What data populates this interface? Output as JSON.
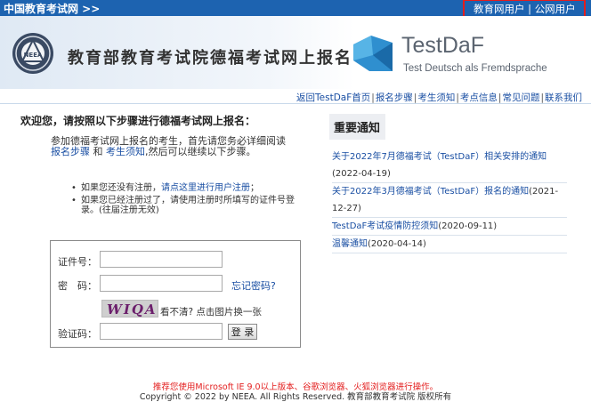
{
  "topbar": {
    "site_name": "中国教育考试网 >>",
    "user_link_edu": "教育网用户",
    "user_sep": " | ",
    "user_link_public": "公网用户",
    "highlight_color": "#e31d1d",
    "bg_color": "#1d63b0"
  },
  "banner": {
    "title": "教育部教育考试院德福考试网上报名",
    "logo_text": "NEEA",
    "brand_name": "TestDaF",
    "brand_sub": "Test Deutsch als Fremdsprache"
  },
  "nav": {
    "items": [
      {
        "label": "返回TestDaF首页"
      },
      {
        "label": "报名步骤"
      },
      {
        "label": "考生须知"
      },
      {
        "label": "考点信息"
      },
      {
        "label": "常见问题"
      },
      {
        "label": "联系我们"
      }
    ],
    "separator": "|"
  },
  "welcome": {
    "heading": "欢迎您，请按照以下步骤进行德福考试网上报名：",
    "intro_before": "参加德福考试网上报名的考生，首先请您务必详细阅读",
    "intro_link1": "报名步骤",
    "intro_and": "和",
    "intro_link2": "考生须知",
    "intro_after": ",然后可以继续以下步骤。",
    "bullet1_before": "如果您还没有注册，",
    "bullet1_link": "请点这里进行用户注册",
    "bullet1_after": "；",
    "bullet2": "如果您已经注册过了，请使用注册时所填写的证件号登录。(往届注册无效)"
  },
  "login": {
    "id_label": "证件号：",
    "id_value": "",
    "password_label": "密　码：",
    "password_value": "",
    "forgot_link": "忘记密码?",
    "captcha_text": "WIQA",
    "captcha_hint": "看不清? 点击图片换一张",
    "captcha_label": "验证码：",
    "captcha_value": "",
    "submit_label": "登 录"
  },
  "notices": {
    "title": "重要通知",
    "items": [
      {
        "title": "关于2022年7月德福考试（TestDaF）相关安排的通知",
        "date": "(2022-04-19)"
      },
      {
        "title": "关于2022年3月德福考试（TestDaF）报名的通知",
        "date": "(2021-12-27)"
      },
      {
        "title": "TestDaF考试疫情防控须知",
        "date": "(2020-09-11)"
      },
      {
        "title": "温馨通知",
        "date": "(2020-04-14)"
      }
    ]
  },
  "footer": {
    "browser_notice": "推荐您使用Microsoft IE 9.0以上版本、谷歌浏览器、火狐浏览器进行操作。",
    "copyright": "Copyright © 2022 by NEEA. All Rights Reserved. 教育部教育考试院 版权所有"
  }
}
